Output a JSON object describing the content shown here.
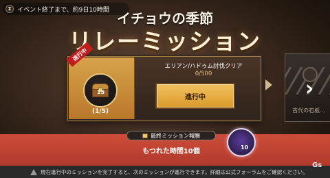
{
  "event": {
    "remaining": "イベント終了まで、約9日10時間",
    "icon": "hourglass-icon"
  },
  "title": {
    "top": "イチョウの季節",
    "main": "リレーミッション"
  },
  "current_mission": {
    "ribbon": "進行中",
    "reward_count": "15",
    "progress_step": "(1/5)",
    "name": "エリアン/ハドゥム討伐クリア",
    "progress": "0/500",
    "button_label": "進行中"
  },
  "next_mission": {
    "label": "古代の石板..."
  },
  "final_reward": {
    "chip_label": "最終ミッション報酬",
    "reward_text": "もつれた時間10個",
    "item_count": "10"
  },
  "footer": {
    "notice": "現在進行中のミッションを完了すると、次のミッションが進行できます。詳細は公式フォーラムをご確認ください。"
  },
  "watermark": "Gs",
  "colors": {
    "accent_orange": "#e0a43c",
    "band_red": "#c4463a",
    "ribbon_red": "#c01d1d"
  }
}
